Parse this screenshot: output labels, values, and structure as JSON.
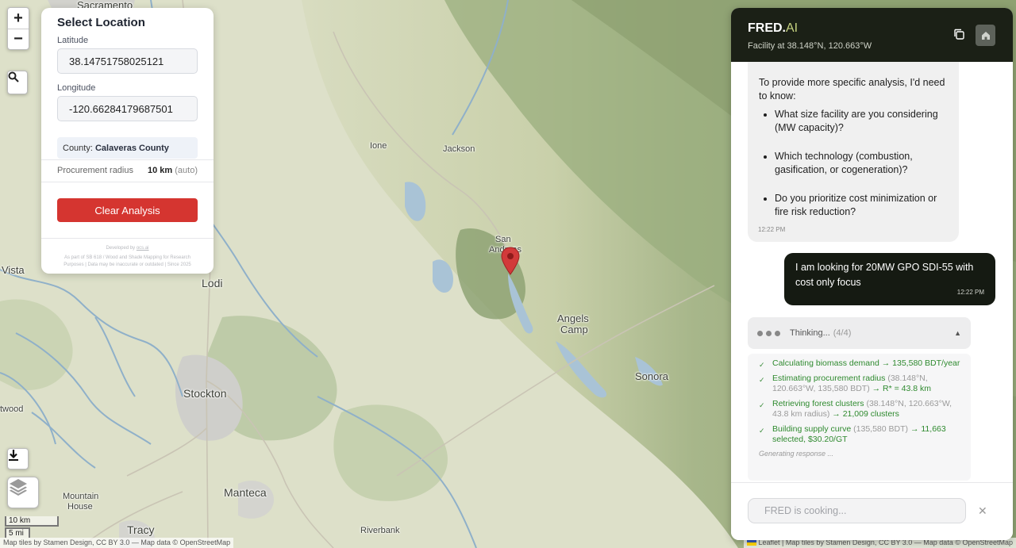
{
  "map": {
    "places": [
      {
        "name": "Sacramento",
        "cls": "md"
      },
      {
        "name": "Ione",
        "cls": "sm"
      },
      {
        "name": "Jackson",
        "cls": "sm"
      },
      {
        "name": "San",
        "cls": "sm"
      },
      {
        "name": "Andreas",
        "cls": "sm"
      },
      {
        "name": "Angels",
        "cls": "md"
      },
      {
        "name": "Camp",
        "cls": "md"
      },
      {
        "name": "Sonora",
        "cls": "md"
      },
      {
        "name": "Lodi",
        "cls": "lg"
      },
      {
        "name": "Vista",
        "cls": "md"
      },
      {
        "name": "Stockton",
        "cls": "lg"
      },
      {
        "name": "twood",
        "cls": "sm"
      },
      {
        "name": "Manteca",
        "cls": "lg"
      },
      {
        "name": "Mountain",
        "cls": "sm"
      },
      {
        "name": "House",
        "cls": "sm"
      },
      {
        "name": "Tracy",
        "cls": "lg"
      },
      {
        "name": "Riverbank",
        "cls": "sm"
      }
    ],
    "scale_km": "10 km",
    "scale_mi": "5 mi",
    "attribution_left": "Map tiles by Stamen Design, CC BY 3.0 — Map data © OpenStreetMap",
    "attribution_right_leaflet": "Leaflet",
    "attribution_right": "| Map tiles by Stamen Design, CC BY 3.0 — Map data © OpenStreetMap",
    "zoom_in": "+",
    "zoom_out": "−",
    "colors": {
      "land": "#dcdcc2",
      "hills": "#b9c49a",
      "forest": "#8fa374",
      "water": "#a9c3d6",
      "marker": "#d23a3a"
    }
  },
  "location_panel": {
    "title": "Select Location",
    "latitude_label": "Latitude",
    "latitude_value": "38.14751758025121",
    "longitude_label": "Longitude",
    "longitude_value": "-120.66284179687501",
    "county_prefix": "County:",
    "county_name": "Calaveras County",
    "radius_label": "Procurement radius",
    "radius_value": "10 km",
    "radius_mode": "(auto)",
    "clear_button": "Clear Analysis",
    "footer_line1": "Developed by",
    "footer_link": "ocs.ai",
    "footer_line2": "As part of SB 618 / Wood and Shade Mapping for Research",
    "footer_line3": "Purposes | Data may be inaccurate or outdated | Since 2025"
  },
  "chat": {
    "brand_main": "FRED.",
    "brand_accent": "AI",
    "subtitle": "Facility at 38.148°N, 120.663°W",
    "bot_message": {
      "intro": "To provide more specific analysis, I'd need to know:",
      "bullets": [
        "What size facility are you considering (MW capacity)?",
        "Which technology (combustion, gasification, or cogeneration)?",
        "Do you prioritize cost minimization or fire risk reduction?"
      ],
      "time": "12:22 PM"
    },
    "user_message": {
      "text": "I am looking for 20MW GPO SDI-55 with cost only focus",
      "time": "12:22 PM"
    },
    "thinking": {
      "label": "Thinking...",
      "count": "(4/4)",
      "steps": [
        {
          "name": "Calculating biomass demand",
          "args": "",
          "result": "→ 135,580 BDT/year"
        },
        {
          "name": "Estimating procurement radius",
          "args": "(38.148°N, 120.663°W, 135,580 BDT)",
          "result": "→ R* = 43.8 km"
        },
        {
          "name": "Retrieving forest clusters",
          "args": "(38.148°N, 120.663°W, 43.8 km radius)",
          "result": "→ 21,009 clusters"
        },
        {
          "name": "Building supply curve",
          "args": "(135,580 BDT)",
          "result": "→ 11,663 selected, $30.20/GT"
        }
      ],
      "generating": "Generating response ..."
    },
    "input_placeholder": "FRED is cooking...",
    "close": "✕"
  }
}
